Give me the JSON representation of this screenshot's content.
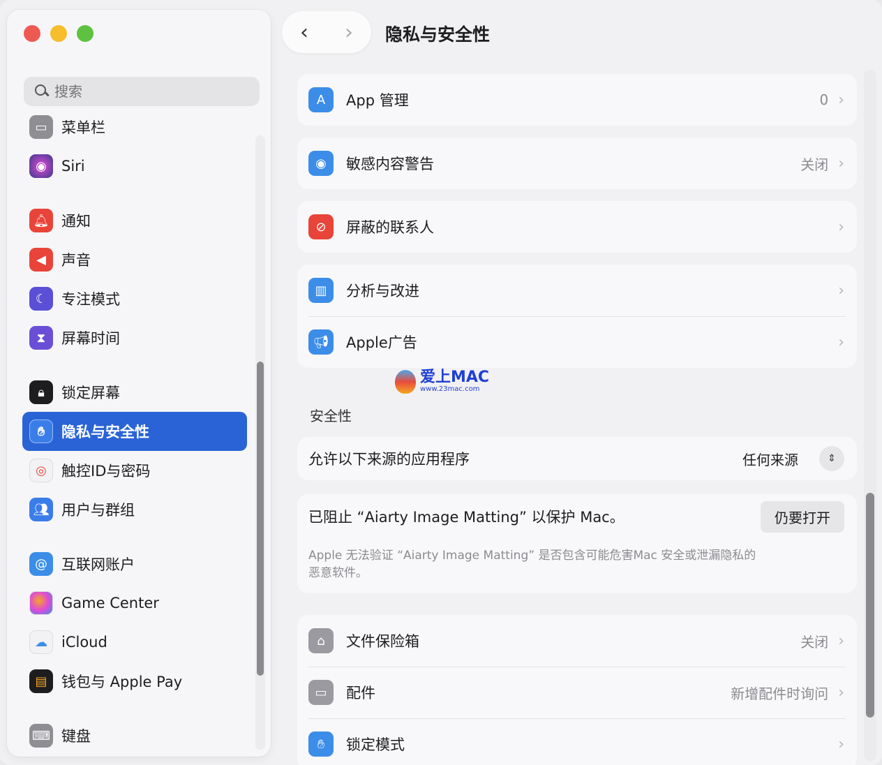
{
  "sidebar": {
    "search_placeholder": "搜索",
    "items": [
      {
        "label": "菜单栏",
        "icon": "menubar-icon",
        "color": "#8e8e93"
      },
      {
        "label": "Siri",
        "icon": "siri-icon",
        "color": "#3a3a8c"
      },
      {
        "label": "通知",
        "icon": "bell-icon",
        "color": "#e8443a"
      },
      {
        "label": "声音",
        "icon": "speaker-icon",
        "color": "#e8443a"
      },
      {
        "label": "专注模式",
        "icon": "moon-icon",
        "color": "#5b4fd6"
      },
      {
        "label": "屏幕时间",
        "icon": "hourglass-icon",
        "color": "#6a4fd6"
      },
      {
        "label": "锁定屏幕",
        "icon": "lock-icon",
        "color": "#1d1d1f"
      },
      {
        "label": "隐私与安全性",
        "icon": "hand-icon",
        "color": "#3b7de8"
      },
      {
        "label": "触控ID与密码",
        "icon": "fingerprint-icon",
        "color": "#f2f2f4"
      },
      {
        "label": "用户与群组",
        "icon": "users-icon",
        "color": "#3b7de8"
      },
      {
        "label": "互联网账户",
        "icon": "at-icon",
        "color": "#3b8de8"
      },
      {
        "label": "Game Center",
        "icon": "gamecenter-icon",
        "color": "#f2f2f4"
      },
      {
        "label": "iCloud",
        "icon": "cloud-icon",
        "color": "#f2f2f4"
      },
      {
        "label": "钱包与 Apple Pay",
        "icon": "wallet-icon",
        "color": "#1d1d1f"
      },
      {
        "label": "键盘",
        "icon": "keyboard-icon",
        "color": "#8e8e93"
      }
    ]
  },
  "header": {
    "back": "‹",
    "forward": "›",
    "title": "隐私与安全性"
  },
  "rows": {
    "app_management": {
      "label": "App 管理",
      "value": "0"
    },
    "sensitive": {
      "label": "敏感内容警告",
      "value": "关闭"
    },
    "blocked": {
      "label": "屏蔽的联系人",
      "value": ""
    },
    "analytics": {
      "label": "分析与改进",
      "value": ""
    },
    "ads": {
      "label": "Apple广告",
      "value": ""
    }
  },
  "watermark": {
    "text": "爱上MAC",
    "url": "www.23mac.com"
  },
  "security": {
    "section_title": "安全性",
    "allow_label": "允许以下来源的应用程序",
    "allow_value": "任何来源",
    "blocked_msg": "已阻止 “Aiarty Image Matting” 以保护 Mac。",
    "open_anyway": "仍要打开",
    "desc": "Apple 无法验证 “Aiarty Image Matting” 是否包含可能危害Mac 安全或泄漏隐私的恶意软件。"
  },
  "rows2": {
    "filevault": {
      "label": "文件保险箱",
      "value": "关闭"
    },
    "accessories": {
      "label": "配件",
      "value": "新增配件时询问"
    },
    "lockdown": {
      "label": "锁定模式",
      "value": ""
    }
  },
  "chevron": "›"
}
